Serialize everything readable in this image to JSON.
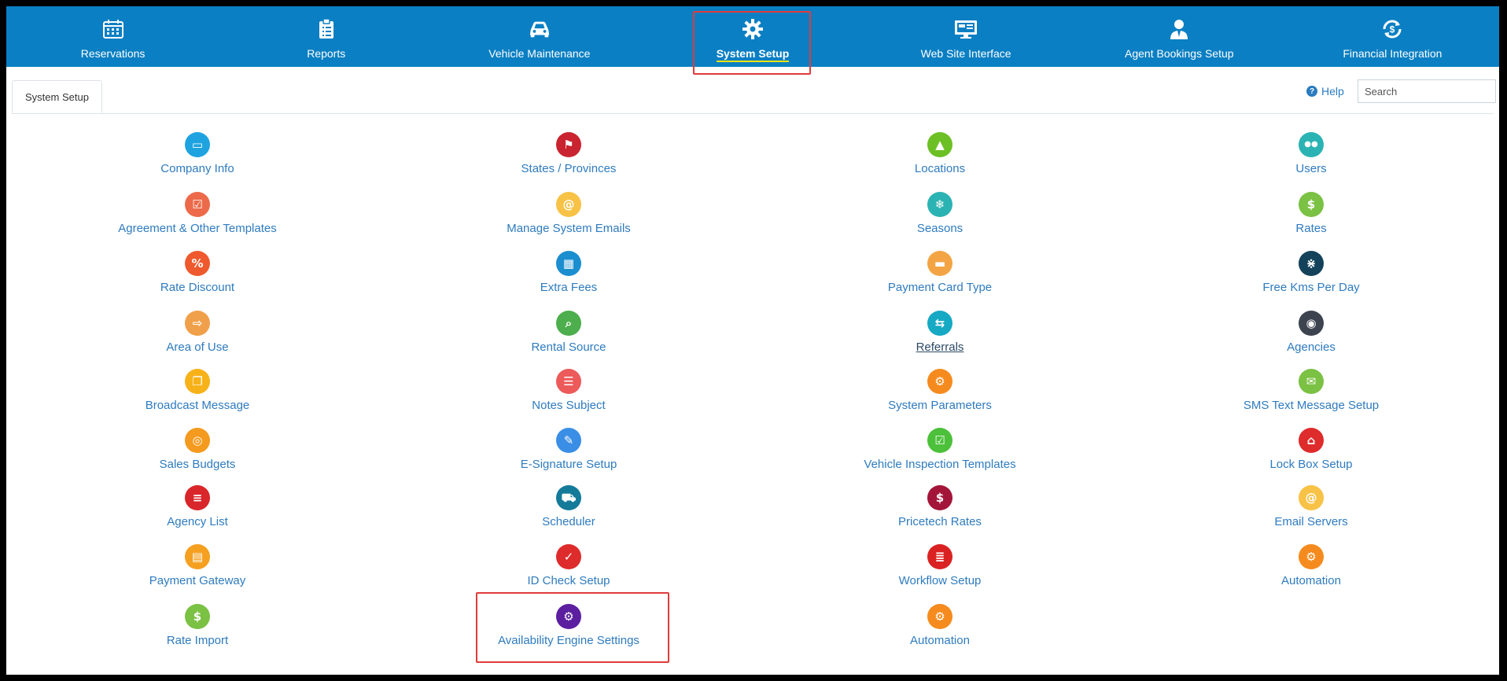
{
  "nav": {
    "items": [
      {
        "label": "Reservations",
        "icon": "calendar-icon"
      },
      {
        "label": "Reports",
        "icon": "clipboard-icon"
      },
      {
        "label": "Vehicle Maintenance",
        "icon": "car-icon"
      },
      {
        "label": "System Setup",
        "icon": "gear-icon",
        "active": true
      },
      {
        "label": "Web Site Interface",
        "icon": "monitor-icon"
      },
      {
        "label": "Agent Bookings Setup",
        "icon": "agent-icon"
      },
      {
        "label": "Financial Integration",
        "icon": "dollar-sync-icon"
      }
    ]
  },
  "tab": {
    "label": "System Setup"
  },
  "help": {
    "label": "Help"
  },
  "search": {
    "placeholder": "Search"
  },
  "columns": [
    [
      {
        "label": "Company Info",
        "icon": "folder-icon",
        "color": "#1fa3e0"
      },
      {
        "label": "Agreement & Other Templates",
        "icon": "checklist-icon",
        "color": "#ec6a4a"
      },
      {
        "label": "Rate Discount",
        "icon": "percent-icon",
        "color": "#ee5a2e"
      },
      {
        "label": "Area of Use",
        "icon": "signpost-icon",
        "color": "#f0a04a"
      },
      {
        "label": "Broadcast Message",
        "icon": "copy-icon",
        "color": "#f7b21a"
      },
      {
        "label": "Sales Budgets",
        "icon": "target-icon",
        "color": "#f49a1e"
      },
      {
        "label": "Agency List",
        "icon": "list-icon",
        "color": "#d9262a"
      },
      {
        "label": "Payment Gateway",
        "icon": "payment-icon",
        "color": "#f6a021"
      },
      {
        "label": "Rate Import",
        "icon": "rate-import-icon",
        "color": "#7bc144"
      }
    ],
    [
      {
        "label": "States / Provinces",
        "icon": "flag-icon",
        "color": "#c9242f"
      },
      {
        "label": "Manage System Emails",
        "icon": "at-icon",
        "color": "#f7c246"
      },
      {
        "label": "Extra Fees",
        "icon": "calculator-icon",
        "color": "#1b8ecf"
      },
      {
        "label": "Rental Source",
        "icon": "magnify-icon",
        "color": "#4cae4c"
      },
      {
        "label": "Notes Subject",
        "icon": "notes-icon",
        "color": "#ec5a5a"
      },
      {
        "label": "E-Signature Setup",
        "icon": "pen-icon",
        "color": "#3a8ee6"
      },
      {
        "label": "Scheduler",
        "icon": "scheduler-car-icon",
        "color": "#147a9a"
      },
      {
        "label": "ID Check Setup",
        "icon": "user-check-icon",
        "color": "#de2b2b"
      },
      {
        "label": "Availability Engine Settings",
        "icon": "engine-icon",
        "color": "#5b1fa0"
      }
    ],
    [
      {
        "label": "Locations",
        "icon": "map-icon",
        "color": "#6cc025"
      },
      {
        "label": "Seasons",
        "icon": "snowflake-icon",
        "color": "#2bb3b3"
      },
      {
        "label": "Payment Card Type",
        "icon": "card-icon",
        "color": "#f3a545"
      },
      {
        "label": "Referrals",
        "icon": "referral-icon",
        "color": "#15a9c4",
        "underline": true
      },
      {
        "label": "System Parameters",
        "icon": "gears-icon",
        "color": "#f58b1e"
      },
      {
        "label": "Vehicle Inspection Templates",
        "icon": "inspection-icon",
        "color": "#4cc03a"
      },
      {
        "label": "Pricetech Rates",
        "icon": "money-bag-icon",
        "color": "#a4153a"
      },
      {
        "label": "Workflow Setup",
        "icon": "document-icon",
        "color": "#db2222"
      },
      {
        "label": "Automation",
        "icon": "gears-icon",
        "color": "#f58b1e"
      }
    ],
    [
      {
        "label": "Users",
        "icon": "users-icon",
        "color": "#2bb3b3"
      },
      {
        "label": "Rates",
        "icon": "rates-icon",
        "color": "#7bc144"
      },
      {
        "label": "Free Kms Per Day",
        "icon": "road-icon",
        "color": "#14425a"
      },
      {
        "label": "Agencies",
        "icon": "agencies-icon",
        "color": "#3d4450"
      },
      {
        "label": "SMS Text Message Setup",
        "icon": "sms-icon",
        "color": "#7bc144"
      },
      {
        "label": "Lock Box Setup",
        "icon": "lockbox-icon",
        "color": "#de2b2b"
      },
      {
        "label": "Email Servers",
        "icon": "at-icon",
        "color": "#f7c246"
      },
      {
        "label": "Automation",
        "icon": "gears-icon",
        "color": "#f58b1e"
      }
    ]
  ]
}
